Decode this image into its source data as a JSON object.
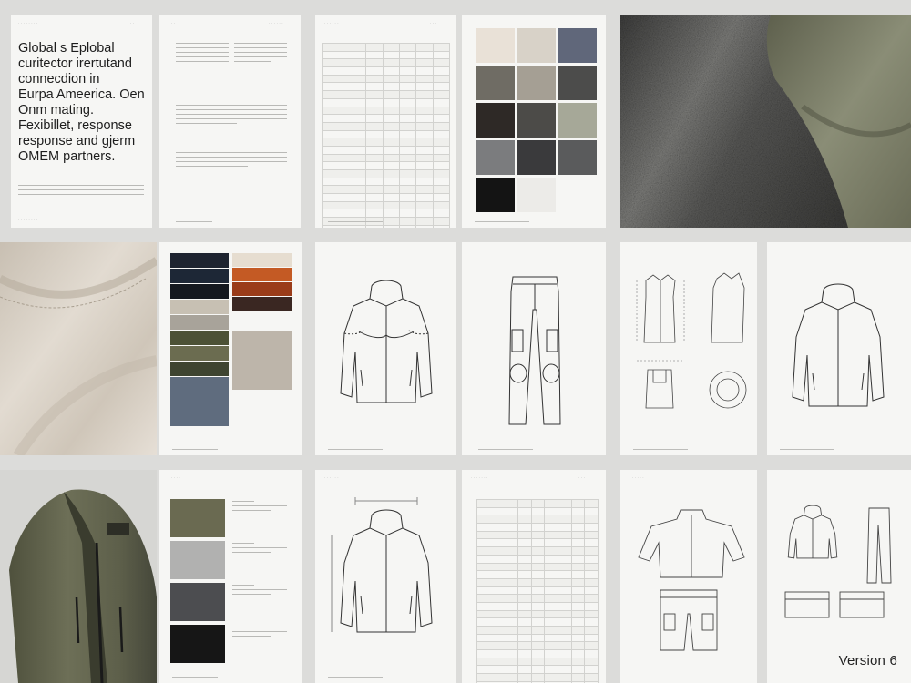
{
  "intro_page": {
    "headline": [
      "Global s Eplobal",
      "curitector irertutand",
      "connecdion in",
      "Eurpa Ameerica. Oen",
      "Onm mating."
    ],
    "subheadline": [
      "Fexibillet, response",
      "response and gjerm",
      "OMEM partners."
    ]
  },
  "version_label": "Version 6",
  "colors": {
    "page": "#f6f6f4",
    "background": "#dcdcda",
    "olive": "#6d6f57",
    "charcoal": "#3a3b3c",
    "beige": "#d9d0c4",
    "orange": "#c45a24",
    "navy": "#1f2633"
  },
  "swatch_sets": {
    "grid_3x5": [
      "#e9e1d7",
      "#d8d2c8",
      "#60677a",
      "#6f6c64",
      "#a59f94",
      "#4c4c4b",
      "#2e2926",
      "#4c4b48",
      "#a6a898",
      "#7b7c7e",
      "#3a3a3c",
      "#5a5b5c",
      "#141414",
      "#ecebe8"
    ],
    "fabric_stack": [
      "#1e2430",
      "#1d2736",
      "#14181f",
      "#c7c0b3",
      "#a8a39a",
      "#4c5136",
      "#6b6c50",
      "#3e4430",
      "#5f6c7e"
    ],
    "fabric_right": [
      "#e6ddd0",
      "#c45a24",
      "#9a3c19",
      "#3a2722",
      "#bdb5aa",
      "#7a7d83"
    ],
    "spec_list": [
      "#6a6a51",
      "#b1b1b0",
      "#4c4d50",
      "#161616"
    ]
  },
  "icons": {
    "jacket": "jacket-sketch-icon",
    "pants": "pants-sketch-icon",
    "vest": "vest-sketch-icon"
  }
}
